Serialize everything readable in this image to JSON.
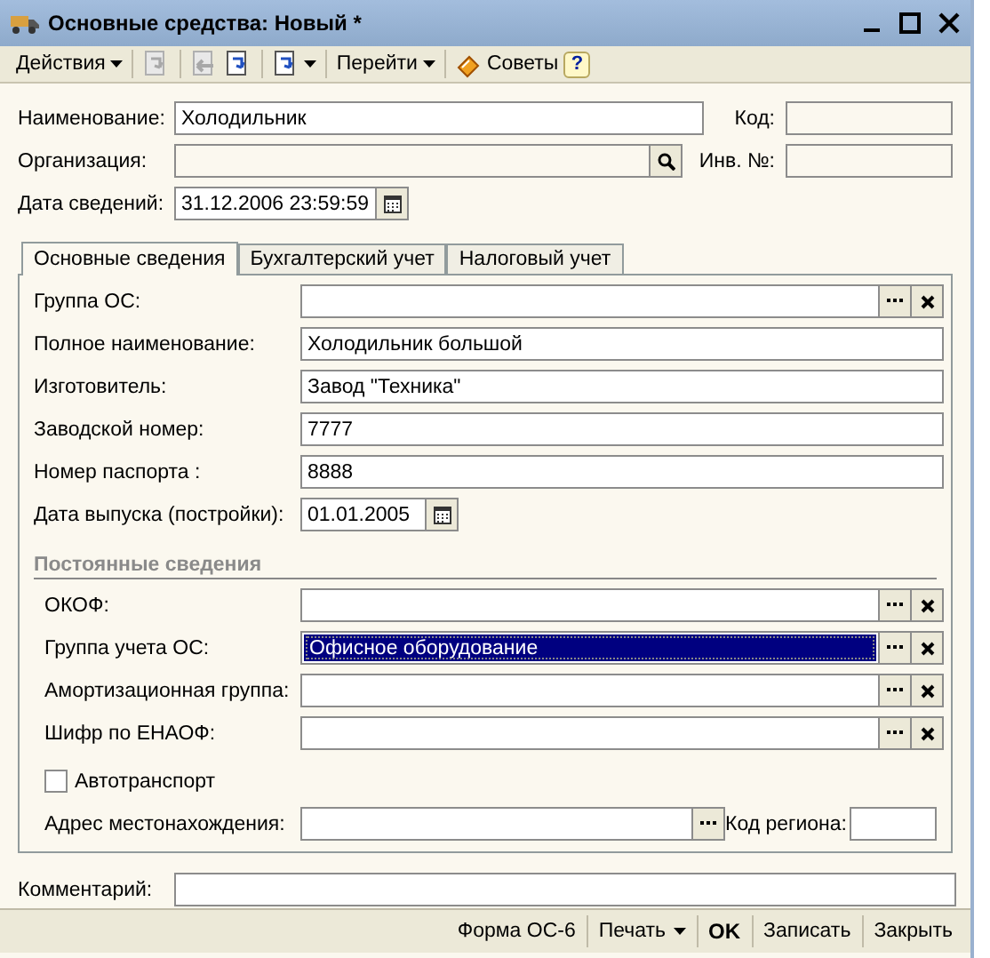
{
  "window": {
    "title": "Основные средства: Новый *"
  },
  "toolbar": [
    [
      {
        "kind": "menu",
        "label": "Действия"
      }
    ],
    [
      {
        "kind": "icon",
        "disabled": true
      }
    ],
    [
      {
        "kind": "icon",
        "disabled": true
      },
      {
        "kind": "icon",
        "disabled": false
      }
    ],
    [
      {
        "kind": "icon-menu",
        "disabled": false
      }
    ],
    [
      {
        "kind": "menu",
        "label": "Перейти"
      }
    ],
    [
      {
        "kind": "tips",
        "label": "Советы"
      },
      {
        "kind": "help",
        "label": "?"
      }
    ]
  ],
  "header": [
    {
      "label": "Наименование:",
      "field": {
        "kind": "text",
        "value": "Холодильник",
        "disabled": false
      },
      "side": {
        "label": "Код:",
        "disabled": true
      }
    },
    {
      "label": "Организация:",
      "field": {
        "kind": "lookup",
        "disabled": true
      },
      "side": {
        "label": "Инв. №:",
        "disabled": true
      }
    },
    {
      "label": "Дата сведений:",
      "field": {
        "kind": "datetime",
        "value": "31.12.2006 23:59:59",
        "disabled": false
      }
    }
  ],
  "tabs": [
    {
      "label": "Основные сведения",
      "selected": true
    },
    {
      "label": "Бухгалтерский учет",
      "selected": false
    },
    {
      "label": "Налоговый учет",
      "selected": false
    }
  ],
  "fields": [
    {
      "label": "Группа ОС:",
      "kind": "choice"
    },
    {
      "label": "Полное наименование:",
      "kind": "text",
      "value": "Холодильник большой"
    },
    {
      "label": "Изготовитель:",
      "kind": "text",
      "value": "Завод \"Техника\""
    },
    {
      "label": "Заводской номер:",
      "kind": "text",
      "value": "7777"
    },
    {
      "label": "Номер паспорта :",
      "kind": "text",
      "value": "8888"
    },
    {
      "label": "Дата выпуска (постройки):",
      "kind": "date",
      "value": "01.01.2005"
    }
  ],
  "section": {
    "title": "Постоянные сведения",
    "items": [
      {
        "label": "ОКОФ:",
        "kind": "choice",
        "selected": false
      },
      {
        "label": "Группа учета ОС:",
        "kind": "choice",
        "value": "Офисное оборудование",
        "selected": true
      },
      {
        "label": "Амортизационная группа:",
        "kind": "choice",
        "selected": false
      },
      {
        "label": "Шифр по ЕНАОФ:",
        "kind": "choice",
        "selected": false
      },
      {
        "label": "Автотранспорт",
        "kind": "checkbox",
        "checked": false,
        "selected": false
      },
      {
        "label": "Адрес местонахождения:",
        "kind": "address",
        "selected": false,
        "side": {
          "label": "Код региона:"
        }
      }
    ]
  },
  "comment": {
    "label": "Комментарий:"
  },
  "footer": [
    {
      "kind": "button",
      "label": "Форма ОС-6"
    },
    {
      "kind": "menu",
      "label": "Печать"
    },
    {
      "kind": "default",
      "label": "OK"
    },
    {
      "kind": "button",
      "label": "Записать"
    },
    {
      "kind": "button",
      "label": "Закрыть"
    }
  ]
}
